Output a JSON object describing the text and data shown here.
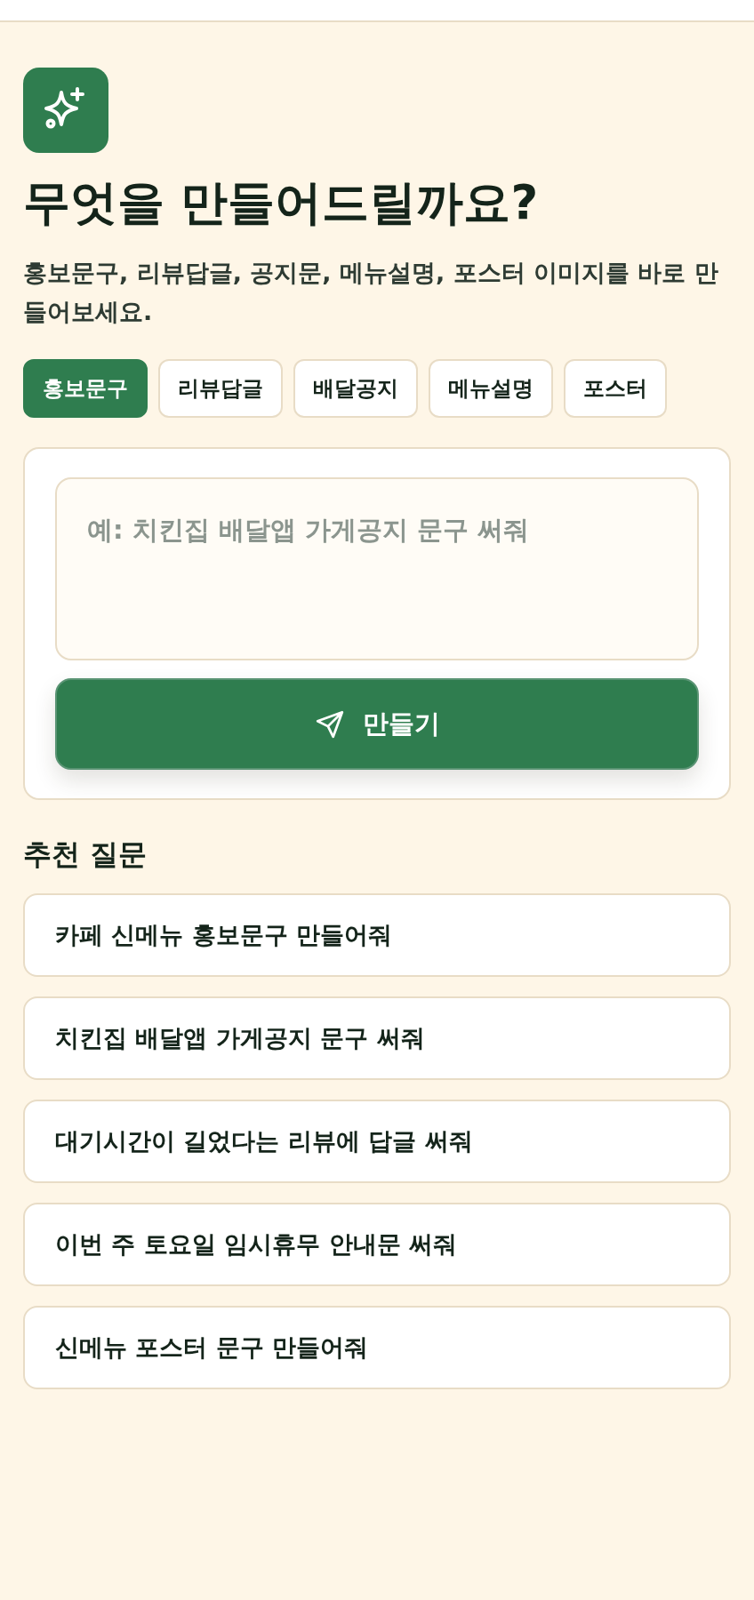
{
  "hero": {
    "title": "무엇을 만들어드릴까요?",
    "subtitle": "홍보문구, 리뷰답글, 공지문, 메뉴설명, 포스터 이미지를 바로 만들어보세요."
  },
  "tabs": [
    {
      "label": "홍보문구",
      "selected": true
    },
    {
      "label": "리뷰답글",
      "selected": false
    },
    {
      "label": "배달공지",
      "selected": false
    },
    {
      "label": "메뉴설명",
      "selected": false
    },
    {
      "label": "포스터",
      "selected": false
    }
  ],
  "composer": {
    "placeholder": "예: 치킨집 배달앱 가게공지 문구 써줘",
    "submit_label": "만들기"
  },
  "suggestions": {
    "title": "추천 질문",
    "items": [
      "카페 신메뉴 홍보문구 만들어줘",
      "치킨집 배달앱 가게공지 문구 써줘",
      "대기시간이 길었다는 리뷰에 답글 써줘",
      "이번 주 토요일 임시휴무 안내문 써줘",
      "신메뉴 포스터 문구 만들어줘"
    ]
  }
}
